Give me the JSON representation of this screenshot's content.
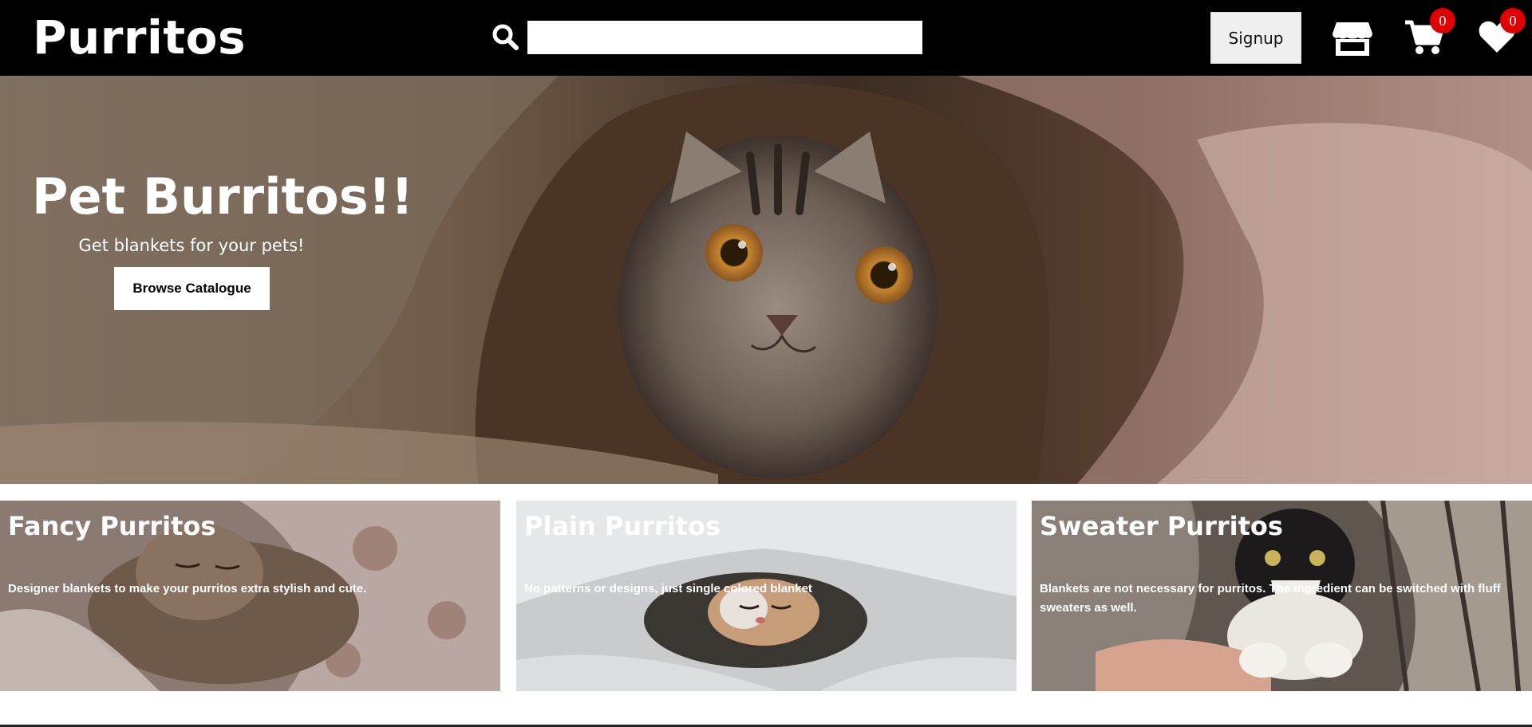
{
  "header": {
    "logo": "Purritos",
    "search": {
      "placeholder": "",
      "value": "",
      "icon": "search-icon"
    },
    "signup_label": "Signup",
    "store_icon": "store-icon",
    "cart": {
      "icon": "shopping-cart-icon",
      "count": "0"
    },
    "wishlist": {
      "icon": "heart-icon",
      "count": "0"
    }
  },
  "hero": {
    "title": "Pet Burritos!!",
    "subtitle": "Get blankets for your pets!",
    "button_label": "Browse Catalogue"
  },
  "categories": [
    {
      "title": "Fancy Purritos",
      "description": "Designer blankets to make your purritos extra stylish and cute."
    },
    {
      "title": "Plain Purritos",
      "description": "No patterns or designs, just single colored blanket"
    },
    {
      "title": "Sweater Purritos",
      "description": "Blankets are not necessary for purritos. The ingredient can be switched with fluff sweaters as well."
    }
  ],
  "colors": {
    "header_bg": "#000000",
    "badge": "#e00000",
    "signup_bg": "#efefef"
  }
}
